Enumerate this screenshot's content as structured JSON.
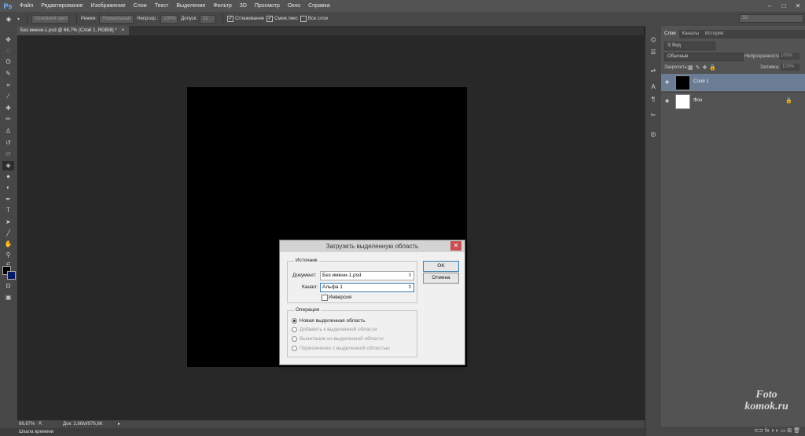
{
  "menubar": {
    "logo": "Ps",
    "items": [
      "Файл",
      "Редактирование",
      "Изображение",
      "Слои",
      "Текст",
      "Выделение",
      "Фильтр",
      "3D",
      "Просмотр",
      "Окно",
      "Справка"
    ],
    "window_controls": [
      "–",
      "□",
      "✕"
    ]
  },
  "options": {
    "fill_source": "Основной цвет",
    "mode_label": "Режим:",
    "mode_value": "Нормальный",
    "opacity_label": "Непрозр.:",
    "opacity_value": "100%",
    "tolerance_label": "Допуск:",
    "tolerance_value": "32",
    "antialias_label": "Сглаживание",
    "contiguous_label": "Смеж.пикс",
    "all_layers_label": "Все слои",
    "workspace_value": "3D"
  },
  "document_tab": {
    "title": "Без имени-1.psd @ 66,7% (Слой 1, RGB/8) *",
    "close": "×"
  },
  "tools": [
    "move-tool",
    "marquee-tool",
    "lasso-tool",
    "quick-select-tool",
    "crop-tool",
    "eyedropper-tool",
    "healing-tool",
    "brush-tool",
    "stamp-tool",
    "history-brush-tool",
    "eraser-tool",
    "paint-bucket-tool",
    "blur-tool",
    "dodge-tool",
    "pen-tool",
    "type-tool",
    "path-select-tool",
    "line-tool",
    "hand-tool",
    "zoom-tool",
    "swap-colors",
    "foreground-color",
    "quickmask",
    "screen-mode"
  ],
  "status": {
    "zoom": "66,67%",
    "doc_info": "Док: 2,86M/976,6K",
    "timeline": "Шкала времени"
  },
  "layers_panel": {
    "tabs": [
      "Слои",
      "Каналы",
      "История"
    ],
    "filter_label": "Вид",
    "blend_mode": "Обычные",
    "opacity_label": "Непрозрачность:",
    "opacity_value": "100%",
    "lock_label": "Закрепить:",
    "fill_label": "Заливка:",
    "fill_value": "100%",
    "layers": [
      {
        "name": "Слой 1",
        "thumb_color": "#000000",
        "selected": true
      },
      {
        "name": "Фон",
        "thumb_color": "#ffffff",
        "selected": false
      }
    ],
    "bottom_icons": "⊂⊃  fx  ◑  ◐  ▭  ⊞  🗑"
  },
  "dialog": {
    "title": "Загрузить выделенную область",
    "source_group": "Источник",
    "document_label": "Документ:",
    "document_value": "Без имени-1.psd",
    "channel_label": "Канал:",
    "channel_value": "Альфа 1",
    "invert_label": "Инверсия",
    "operation_group": "Операция",
    "operations": [
      {
        "label": "Новая выделенная область",
        "enabled": true,
        "selected": true
      },
      {
        "label": "Добавить к выделенной области",
        "enabled": false,
        "selected": false
      },
      {
        "label": "Вычитание из выделенной области",
        "enabled": false,
        "selected": false
      },
      {
        "label": "Пересечение с выделенной областью",
        "enabled": false,
        "selected": false
      }
    ],
    "ok_label": "OK",
    "cancel_label": "Отмена"
  },
  "watermark": {
    "line1": "Foto",
    "line2": "komok.ru"
  },
  "colors": {
    "accent_selected_layer": "#6b7c95",
    "close_button": "#c75050"
  }
}
